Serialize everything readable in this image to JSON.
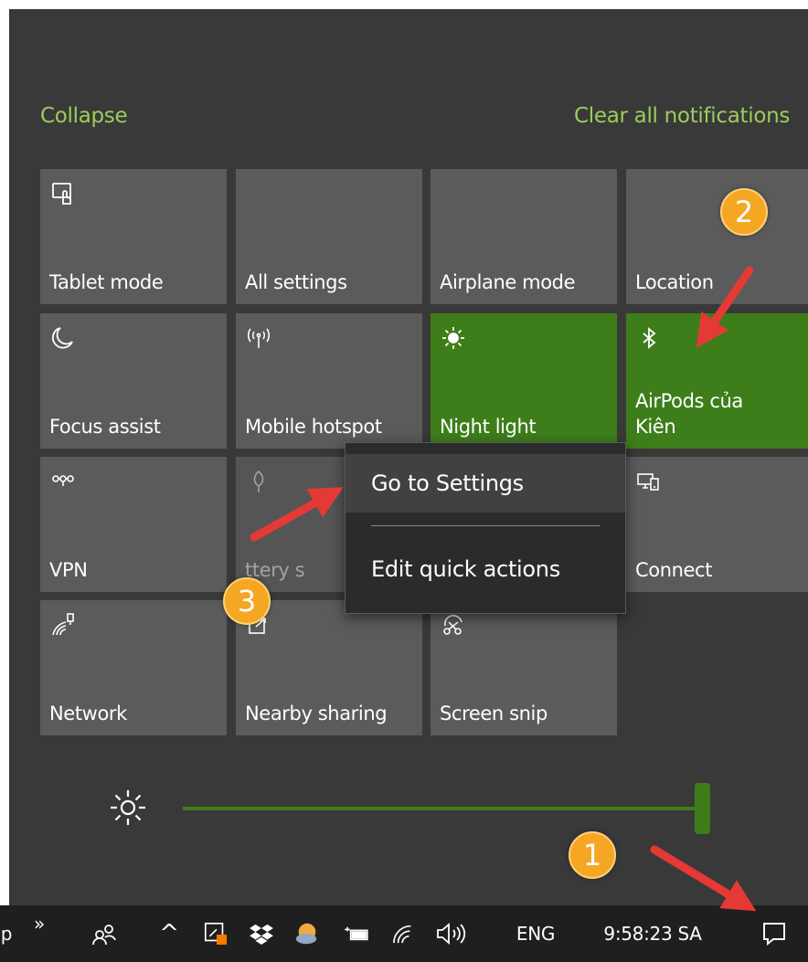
{
  "header": {
    "collapse_label": "Collapse",
    "clear_all_label": "Clear all notifications"
  },
  "quick_actions": [
    {
      "label": "Tablet mode",
      "icon": "tablet-mode-icon",
      "state": "off"
    },
    {
      "label": "All settings",
      "icon": "",
      "state": "off"
    },
    {
      "label": "Airplane mode",
      "icon": "",
      "state": "off"
    },
    {
      "label": "Location",
      "icon": "",
      "state": "off"
    },
    {
      "label": "Focus assist",
      "icon": "moon-icon",
      "state": "off"
    },
    {
      "label": "Mobile hotspot",
      "icon": "hotspot-icon",
      "state": "off"
    },
    {
      "label": "Night light",
      "icon": "sun-icon",
      "state": "on"
    },
    {
      "label": "AirPods của\nKiên",
      "label_line1": "AirPods của",
      "label_line2": "Kiên",
      "icon": "bluetooth-icon",
      "state": "on"
    },
    {
      "label": "VPN",
      "icon": "vpn-icon",
      "state": "off"
    },
    {
      "label": "Battery saver",
      "visible_text": "ttery s",
      "icon": "leaf-icon",
      "state": "disabled"
    },
    {
      "label": "Connect",
      "icon": "connect-icon",
      "state": "off"
    },
    {
      "label": "Network",
      "icon": "network-icon",
      "state": "off"
    },
    {
      "label": "Nearby sharing",
      "icon": "share-icon",
      "state": "off"
    },
    {
      "label": "Screen snip",
      "icon": "screen-snip-icon",
      "state": "off"
    }
  ],
  "context_menu": {
    "items": [
      "Go to Settings",
      "Edit quick actions"
    ]
  },
  "brightness": {
    "level_percent": 100,
    "icon": "brightness-icon"
  },
  "taskbar": {
    "left_fragment": "p",
    "overflow_glyph": "»",
    "people_icon": "people-icon",
    "show_hidden_glyph": "^",
    "tray_icons": [
      "pen-workspace-icon",
      "dropbox-icon",
      "weather-icon",
      "battery-icon",
      "wifi-icon",
      "volume-icon"
    ],
    "language": "ENG",
    "clock": "9:58:23 SA",
    "action_center_icon": "action-center-icon"
  },
  "annotations": {
    "badges": [
      "1",
      "2",
      "3"
    ]
  },
  "colors": {
    "panel_bg": "#393939",
    "tile_bg": "#5b5b5b",
    "tile_on": "#3d7e1b",
    "link_green": "#9ccd5a",
    "badge_orange": "#f5a623",
    "arrow_red": "#e53935",
    "menu_bg": "#2b2b2b",
    "taskbar_bg": "#1f1f1f"
  }
}
